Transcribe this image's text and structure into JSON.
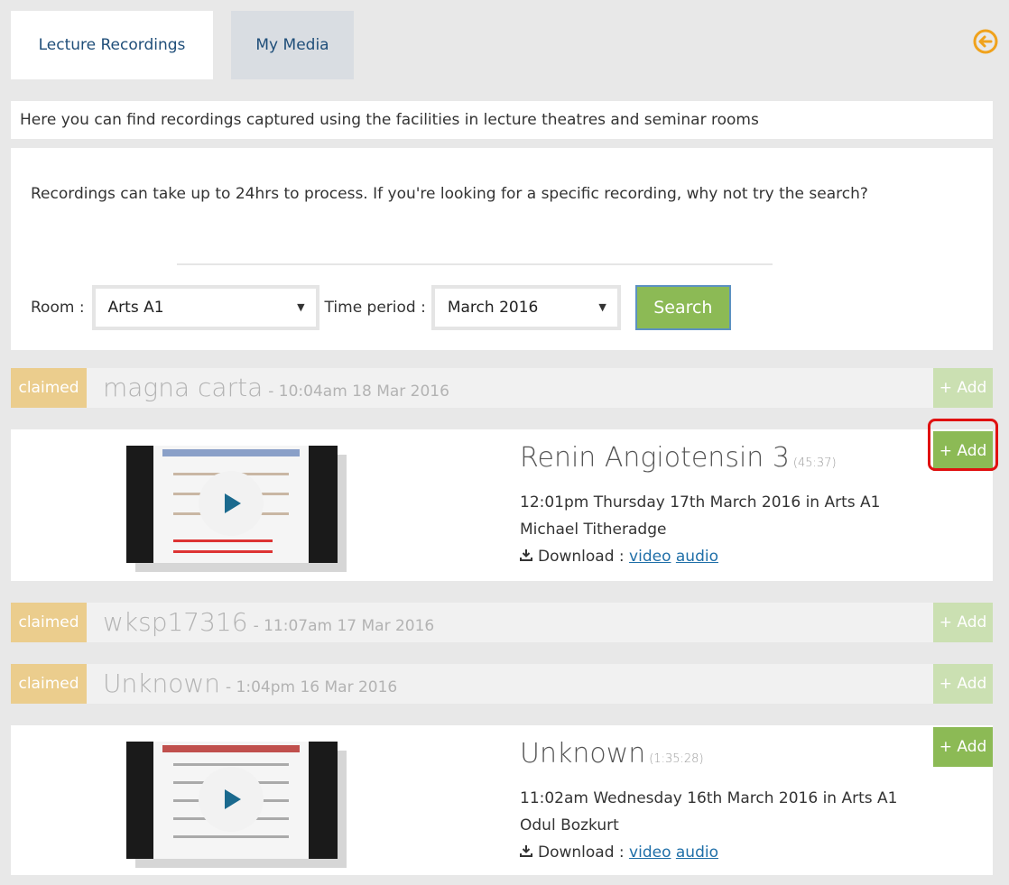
{
  "tabs": {
    "lecture": "Lecture Recordings",
    "media": "My Media"
  },
  "intro": "Here you can find recordings captured using the facilities in lecture theatres and seminar rooms",
  "search": {
    "note": "Recordings can take up to 24hrs to process. If you're looking for a specific recording, why not try the search?",
    "room_label": "Room :",
    "room_value": "Arts A1",
    "period_label": "Time period :",
    "period_value": "March 2016",
    "button": "Search"
  },
  "add_label": "+ Add",
  "claimed_label": "claimed",
  "rows": [
    {
      "name": "magna carta",
      "when": "- 10:04am 18 Mar 2016"
    },
    {
      "name": "wksp17316",
      "when": "- 11:07am 17 Mar 2016"
    },
    {
      "name": "Unknown",
      "when": "- 1:04pm 16 Mar 2016"
    }
  ],
  "cards": [
    {
      "title": "Renin Angiotensin 3",
      "duration": "(45:37)",
      "datetime": "12:01pm Thursday 17th March 2016 in Arts A1",
      "presenter": "Michael Titheradge",
      "download_label": "Download :",
      "video": "video",
      "audio": "audio"
    },
    {
      "title": "Unknown",
      "duration": "(1:35:28)",
      "datetime": "11:02am Wednesday 16th March 2016 in Arts A1",
      "presenter": "Odul Bozkurt",
      "download_label": "Download :",
      "video": "video",
      "audio": "audio"
    }
  ],
  "colors": {
    "accent_green": "#8cba55",
    "claimed": "#ebcd8d",
    "highlight": "#e01010"
  }
}
